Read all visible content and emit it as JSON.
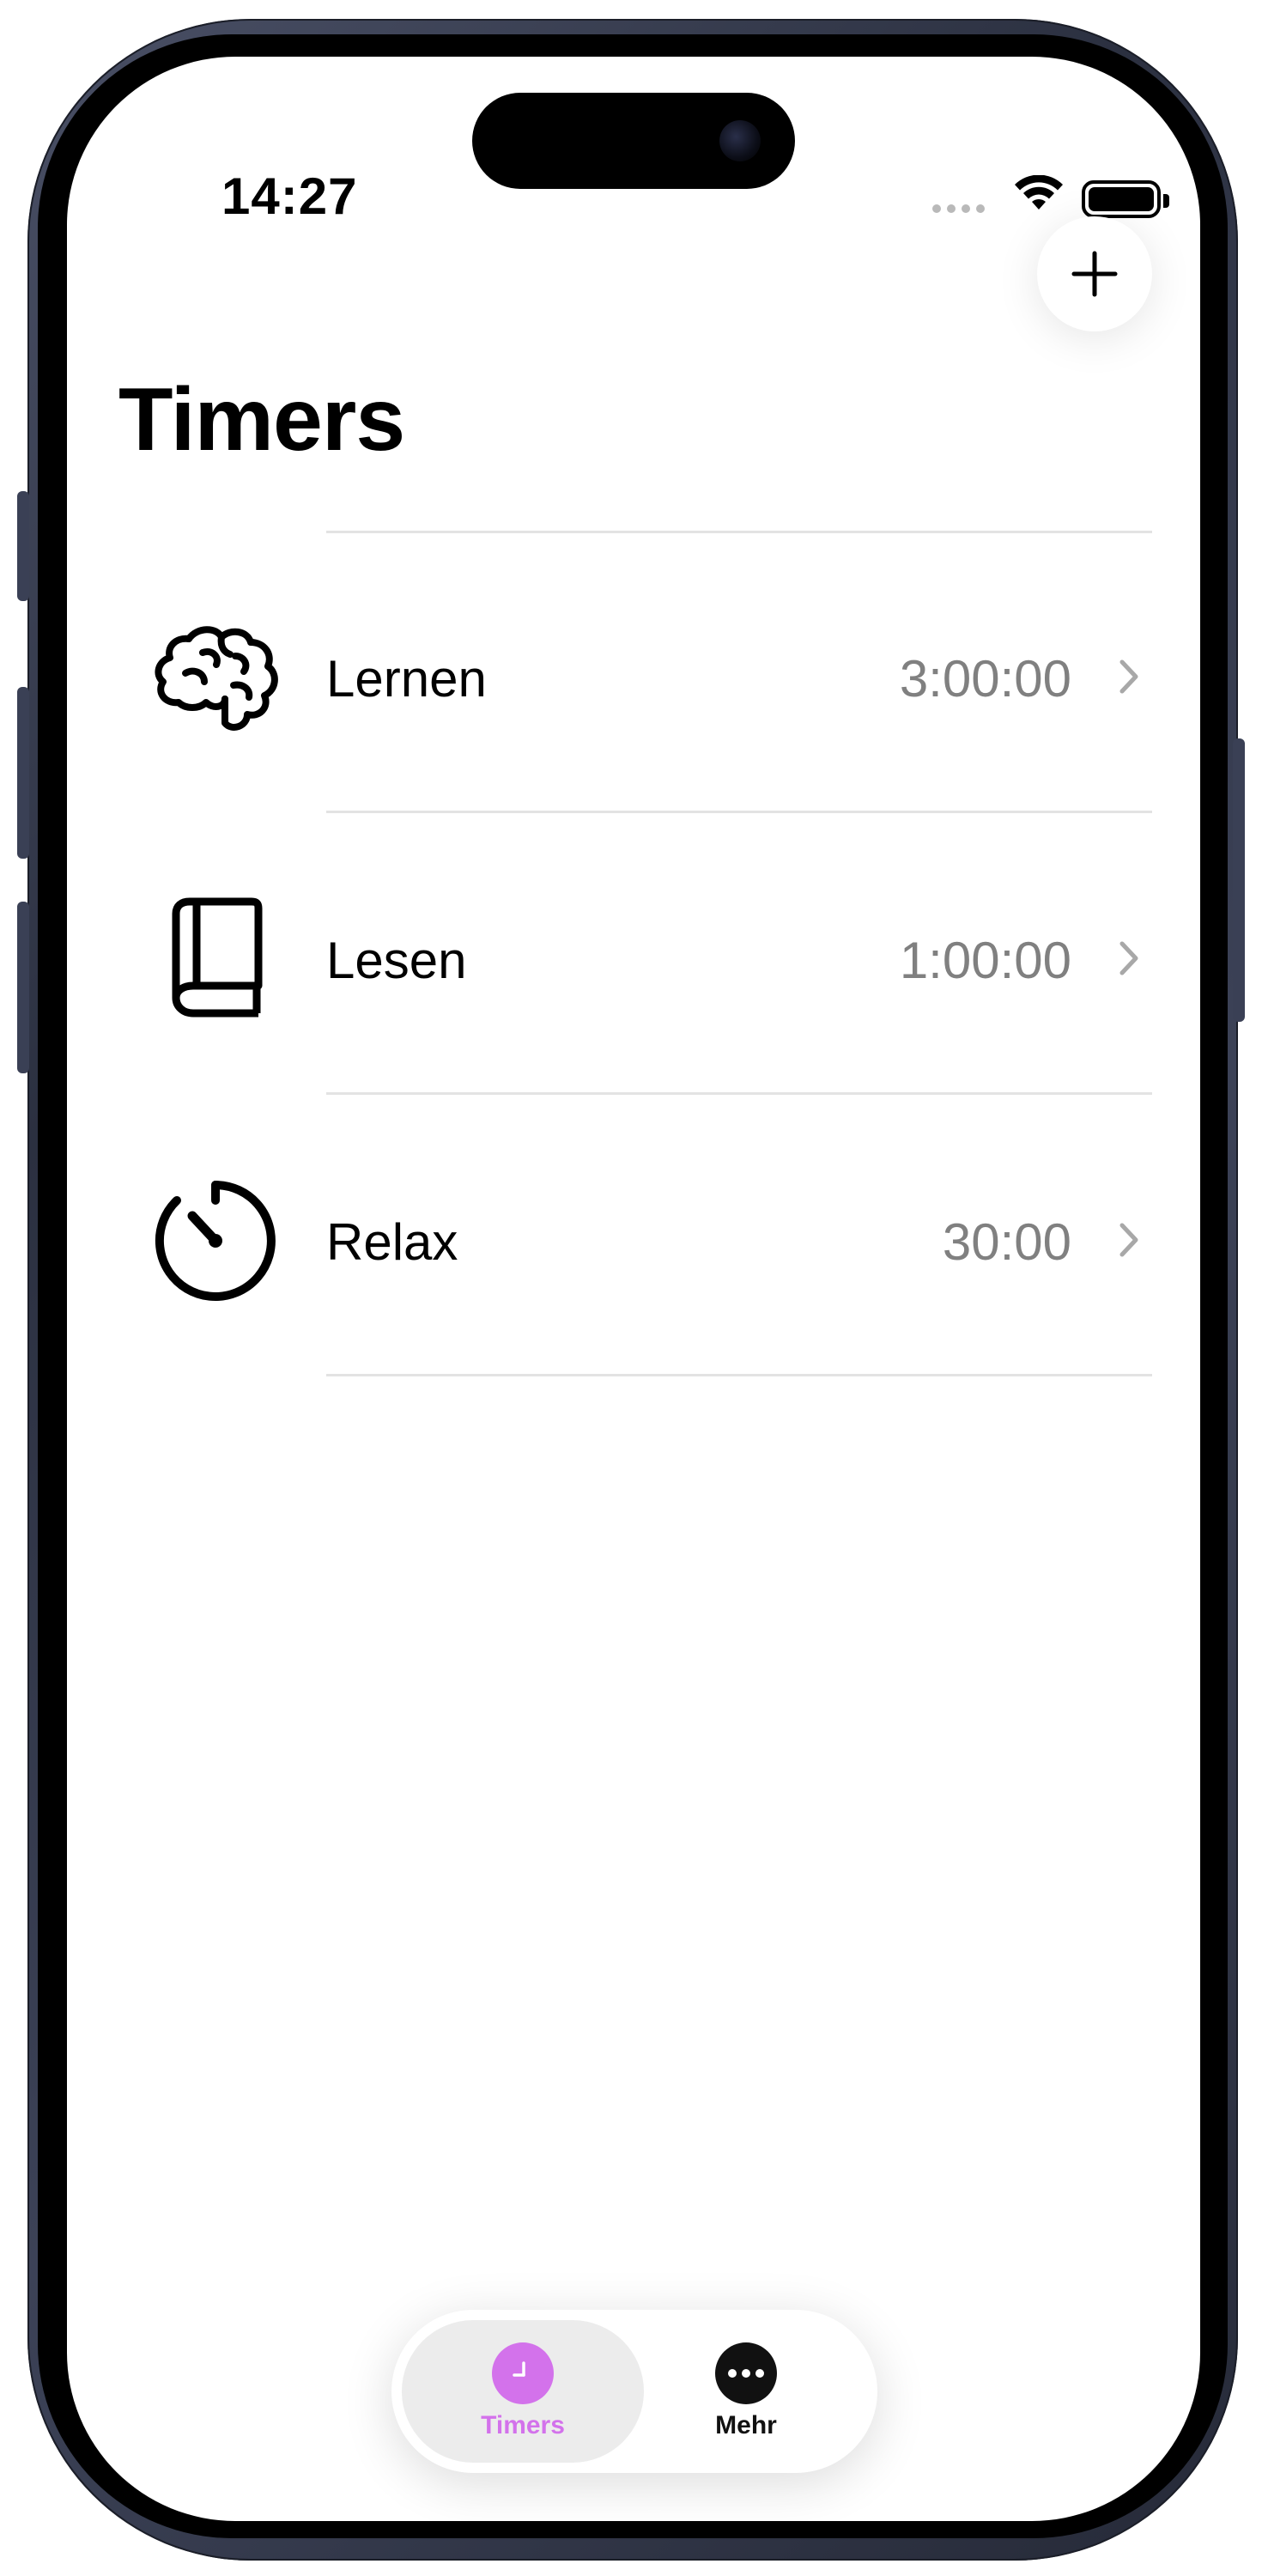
{
  "status_bar": {
    "time": "14:27"
  },
  "header": {
    "title": "Timers",
    "add_icon": "plus-icon"
  },
  "timers": [
    {
      "name": "Lernen",
      "duration": "3:00:00",
      "icon": "brain-icon"
    },
    {
      "name": "Lesen",
      "duration": "1:00:00",
      "icon": "book-icon"
    },
    {
      "name": "Relax",
      "duration": "30:00",
      "icon": "timer-icon"
    }
  ],
  "tab_bar": {
    "tabs": [
      {
        "label": "Timers",
        "icon": "clock-icon",
        "selected": true
      },
      {
        "label": "Mehr",
        "icon": "ellipsis-icon",
        "selected": false
      }
    ]
  },
  "colors": {
    "accent": "#D372EB",
    "secondary_text": "#808080",
    "divider": "#E3E3E3",
    "selected_tab_bg": "#ECECEC"
  }
}
